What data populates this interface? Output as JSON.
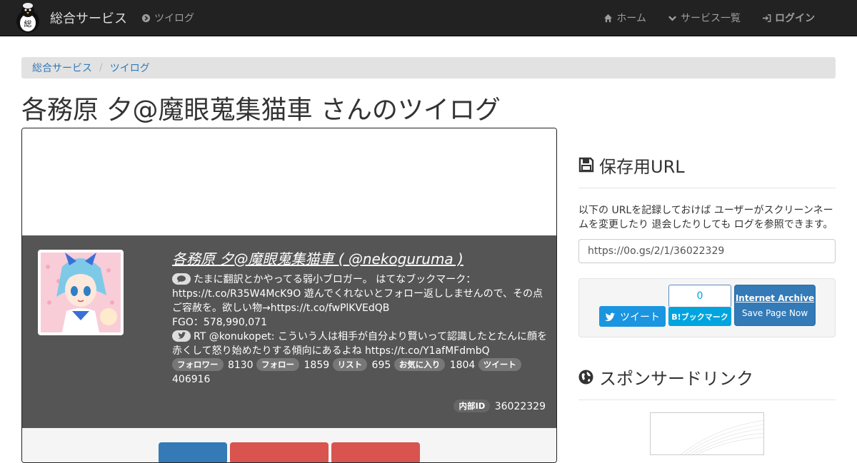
{
  "navbar": {
    "brand": "総合サービス",
    "brand_logo_char": "総",
    "left_link": "ツイログ",
    "right_links": [
      {
        "label": "ホーム",
        "icon": "home-icon"
      },
      {
        "label": "サービス一覧",
        "icon": "chevron-down-icon"
      },
      {
        "label": "ログイン",
        "icon": "sign-in-icon"
      }
    ]
  },
  "breadcrumb": [
    "総合サービス",
    "ツイログ"
  ],
  "page_title": "各務原 夕@魔眼蒐集猫車 さんのツイログ",
  "profile": {
    "name_link": "各務原 夕@魔眼蒐集猫車 ( @nekoguruma )",
    "bio": "たまに翻訳とかやってる弱小ブロガー。 はてなブックマーク：https://t.co/R35W4McK9O 遊んでくれないとフォロー返ししませんので、その点ご容赦を。欲しい物→https://t.co/fwPlKVEdQB",
    "bio_line2": "FGO：578,990,071",
    "last_tweet": "RT @konukopet: こういう人は相手が自分より賢いって認識したとたんに顔を赤くして怒り始めたりする傾向にあるよね https://t.co/Y1afMFdmbQ",
    "stats": [
      {
        "label": "フォロワー",
        "value": "8130"
      },
      {
        "label": "フォロー",
        "value": "1859"
      },
      {
        "label": "リスト",
        "value": "695"
      },
      {
        "label": "お気に入り",
        "value": "1804"
      },
      {
        "label": "ツイート",
        "value": "406916"
      }
    ],
    "internal_id_label": "内部ID",
    "internal_id": "36022329"
  },
  "side": {
    "save_title": "保存用URL",
    "save_desc": "以下の URLを記録しておけば ユーザーがスクリーンネームを変更したり 退会したりしても ログを参照できます。",
    "save_url": "https://0o.gs/2/1/36022329",
    "tweet_btn": "ツイート",
    "hatena_count": "0",
    "hatena_btn": "B!ブックマーク",
    "ia_title": "Internet Archive",
    "ia_sub": "Save Page Now",
    "sponsor_title": "スポンサードリンク"
  },
  "colors": {
    "navbar": "#222222",
    "profile_bg": "#555555",
    "link": "#337ab7",
    "twitter": "#1b95e0",
    "hatena": "#00a4de",
    "danger": "#d9534f"
  }
}
